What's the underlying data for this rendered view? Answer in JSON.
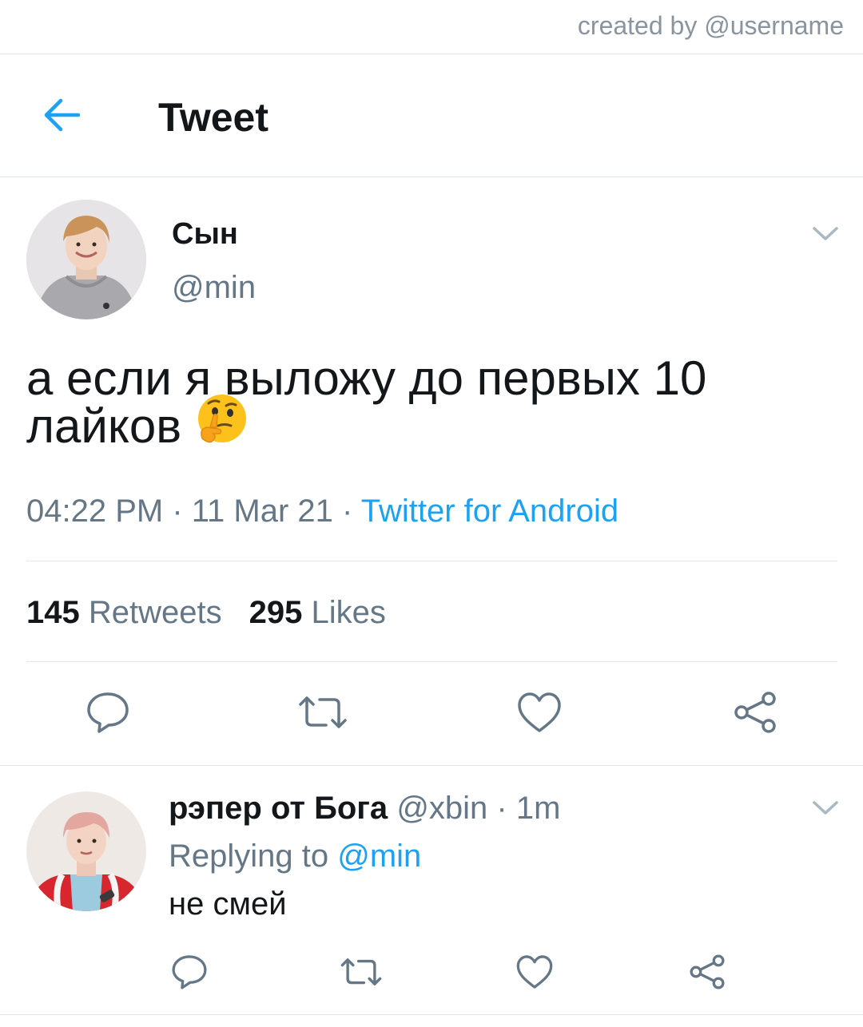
{
  "watermark": "created by @username",
  "header": {
    "title": "Tweet",
    "back_icon": "arrow-left-icon"
  },
  "tweet": {
    "author_name": "Сын",
    "author_handle": "@min",
    "text_line1": "а если я выложу до первых 10",
    "text_line2": "лайков",
    "emoji": "thinking-face-emoji",
    "time": "04:22 PM",
    "sep1": " · ",
    "date": "11 Mar 21",
    "sep2": " · ",
    "source": "Twitter for Android",
    "retweets_count": "145",
    "retweets_label": "Retweets",
    "likes_count": "295",
    "likes_label": "Likes",
    "actions": [
      "reply-icon",
      "retweet-icon",
      "like-icon",
      "share-icon"
    ]
  },
  "reply": {
    "author_name": "рэпер от Бога",
    "author_handle": "@xbin",
    "time_sep": " · ",
    "time": "1m",
    "replying_prefix": "Replying to ",
    "replying_to": "@min",
    "text": "не смей",
    "actions": [
      "reply-icon",
      "retweet-icon",
      "like-icon",
      "share-icon"
    ]
  },
  "colors": {
    "accent": "#1da1f2",
    "text": "#14171a",
    "muted": "#657786",
    "icon": "#657786",
    "divider": "#e1e8ed"
  }
}
